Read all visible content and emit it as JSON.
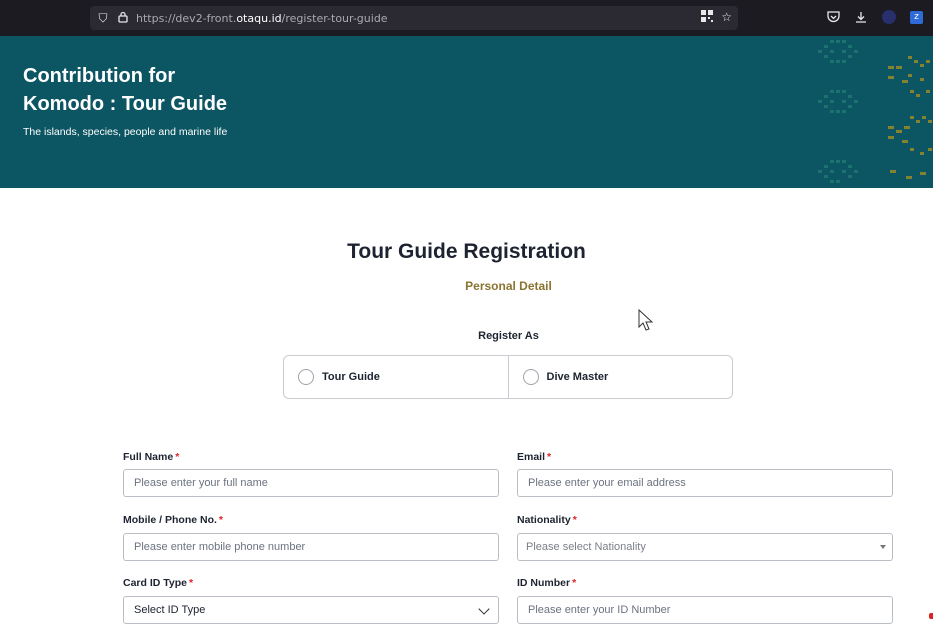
{
  "browser": {
    "url_prefix": "https://dev2-front.",
    "url_host": "otaqu.id",
    "url_path": "/register-tour-guide"
  },
  "hero": {
    "title_line1": "Contribution for",
    "title_line2": "Komodo : Tour Guide",
    "subtitle": "The islands, species, people and marine life",
    "background_color": "#0c5562"
  },
  "form": {
    "title": "Tour Guide Registration",
    "section": "Personal Detail",
    "register_as_label": "Register As",
    "register_options": [
      "Tour Guide",
      "Dive Master"
    ],
    "required_mark": "*",
    "fields": {
      "full_name": {
        "label": "Full Name",
        "placeholder": "Please enter your full name"
      },
      "email": {
        "label": "Email",
        "placeholder": "Please enter your email address"
      },
      "phone": {
        "label": "Mobile / Phone No.",
        "placeholder": "Please enter mobile phone number"
      },
      "nationality": {
        "label": "Nationality",
        "placeholder": "Please select Nationality"
      },
      "card_id_type": {
        "label": "Card ID Type",
        "value": "Select ID Type"
      },
      "id_number": {
        "label": "ID Number",
        "placeholder": "Please enter your ID Number"
      }
    }
  },
  "colors": {
    "accent_gold": "#8a7430",
    "required_red": "#e02424"
  }
}
